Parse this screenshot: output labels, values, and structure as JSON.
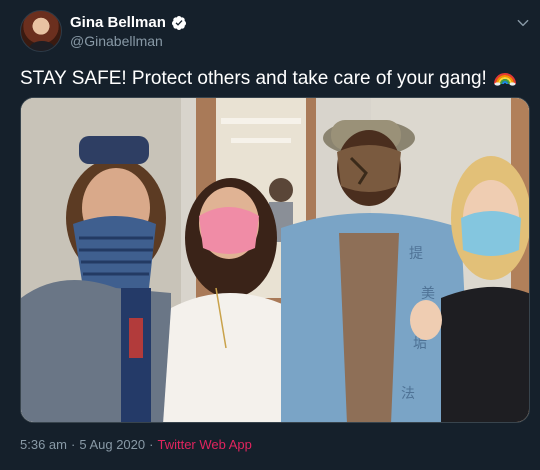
{
  "author": {
    "name": "Gina Bellman",
    "handle": "@Ginabellman",
    "avatar_icon": "profile-photo",
    "verified_icon": "verified-badge-icon"
  },
  "tweet": {
    "text": "STAY SAFE! Protect others and take care of your gang!",
    "emoji": "rainbow-emoji"
  },
  "media": {
    "description_icon": "group-photo-four-people-masks"
  },
  "meta": {
    "time": "5:36 am",
    "separator": "·",
    "date": "5 Aug 2020",
    "separator2": "·",
    "source": "Twitter Web App"
  },
  "colors": {
    "background": "#15202b",
    "text_primary": "#ffffff",
    "text_secondary": "#8899a6",
    "verified": "#ffffff",
    "source_link": "#e0245e",
    "border": "#38444d"
  }
}
